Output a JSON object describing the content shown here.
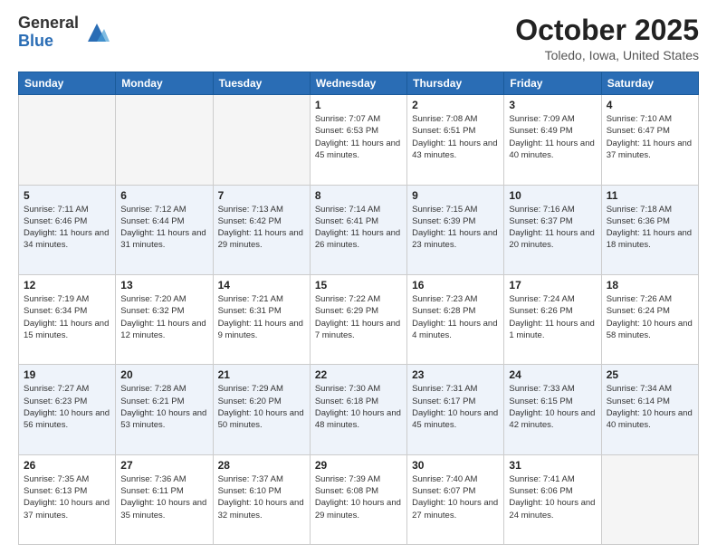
{
  "logo": {
    "general": "General",
    "blue": "Blue"
  },
  "header": {
    "month": "October 2025",
    "location": "Toledo, Iowa, United States"
  },
  "days_of_week": [
    "Sunday",
    "Monday",
    "Tuesday",
    "Wednesday",
    "Thursday",
    "Friday",
    "Saturday"
  ],
  "weeks": [
    [
      {
        "day": "",
        "info": ""
      },
      {
        "day": "",
        "info": ""
      },
      {
        "day": "",
        "info": ""
      },
      {
        "day": "1",
        "info": "Sunrise: 7:07 AM\nSunset: 6:53 PM\nDaylight: 11 hours\nand 45 minutes."
      },
      {
        "day": "2",
        "info": "Sunrise: 7:08 AM\nSunset: 6:51 PM\nDaylight: 11 hours\nand 43 minutes."
      },
      {
        "day": "3",
        "info": "Sunrise: 7:09 AM\nSunset: 6:49 PM\nDaylight: 11 hours\nand 40 minutes."
      },
      {
        "day": "4",
        "info": "Sunrise: 7:10 AM\nSunset: 6:47 PM\nDaylight: 11 hours\nand 37 minutes."
      }
    ],
    [
      {
        "day": "5",
        "info": "Sunrise: 7:11 AM\nSunset: 6:46 PM\nDaylight: 11 hours\nand 34 minutes."
      },
      {
        "day": "6",
        "info": "Sunrise: 7:12 AM\nSunset: 6:44 PM\nDaylight: 11 hours\nand 31 minutes."
      },
      {
        "day": "7",
        "info": "Sunrise: 7:13 AM\nSunset: 6:42 PM\nDaylight: 11 hours\nand 29 minutes."
      },
      {
        "day": "8",
        "info": "Sunrise: 7:14 AM\nSunset: 6:41 PM\nDaylight: 11 hours\nand 26 minutes."
      },
      {
        "day": "9",
        "info": "Sunrise: 7:15 AM\nSunset: 6:39 PM\nDaylight: 11 hours\nand 23 minutes."
      },
      {
        "day": "10",
        "info": "Sunrise: 7:16 AM\nSunset: 6:37 PM\nDaylight: 11 hours\nand 20 minutes."
      },
      {
        "day": "11",
        "info": "Sunrise: 7:18 AM\nSunset: 6:36 PM\nDaylight: 11 hours\nand 18 minutes."
      }
    ],
    [
      {
        "day": "12",
        "info": "Sunrise: 7:19 AM\nSunset: 6:34 PM\nDaylight: 11 hours\nand 15 minutes."
      },
      {
        "day": "13",
        "info": "Sunrise: 7:20 AM\nSunset: 6:32 PM\nDaylight: 11 hours\nand 12 minutes."
      },
      {
        "day": "14",
        "info": "Sunrise: 7:21 AM\nSunset: 6:31 PM\nDaylight: 11 hours\nand 9 minutes."
      },
      {
        "day": "15",
        "info": "Sunrise: 7:22 AM\nSunset: 6:29 PM\nDaylight: 11 hours\nand 7 minutes."
      },
      {
        "day": "16",
        "info": "Sunrise: 7:23 AM\nSunset: 6:28 PM\nDaylight: 11 hours\nand 4 minutes."
      },
      {
        "day": "17",
        "info": "Sunrise: 7:24 AM\nSunset: 6:26 PM\nDaylight: 11 hours\nand 1 minute."
      },
      {
        "day": "18",
        "info": "Sunrise: 7:26 AM\nSunset: 6:24 PM\nDaylight: 10 hours\nand 58 minutes."
      }
    ],
    [
      {
        "day": "19",
        "info": "Sunrise: 7:27 AM\nSunset: 6:23 PM\nDaylight: 10 hours\nand 56 minutes."
      },
      {
        "day": "20",
        "info": "Sunrise: 7:28 AM\nSunset: 6:21 PM\nDaylight: 10 hours\nand 53 minutes."
      },
      {
        "day": "21",
        "info": "Sunrise: 7:29 AM\nSunset: 6:20 PM\nDaylight: 10 hours\nand 50 minutes."
      },
      {
        "day": "22",
        "info": "Sunrise: 7:30 AM\nSunset: 6:18 PM\nDaylight: 10 hours\nand 48 minutes."
      },
      {
        "day": "23",
        "info": "Sunrise: 7:31 AM\nSunset: 6:17 PM\nDaylight: 10 hours\nand 45 minutes."
      },
      {
        "day": "24",
        "info": "Sunrise: 7:33 AM\nSunset: 6:15 PM\nDaylight: 10 hours\nand 42 minutes."
      },
      {
        "day": "25",
        "info": "Sunrise: 7:34 AM\nSunset: 6:14 PM\nDaylight: 10 hours\nand 40 minutes."
      }
    ],
    [
      {
        "day": "26",
        "info": "Sunrise: 7:35 AM\nSunset: 6:13 PM\nDaylight: 10 hours\nand 37 minutes."
      },
      {
        "day": "27",
        "info": "Sunrise: 7:36 AM\nSunset: 6:11 PM\nDaylight: 10 hours\nand 35 minutes."
      },
      {
        "day": "28",
        "info": "Sunrise: 7:37 AM\nSunset: 6:10 PM\nDaylight: 10 hours\nand 32 minutes."
      },
      {
        "day": "29",
        "info": "Sunrise: 7:39 AM\nSunset: 6:08 PM\nDaylight: 10 hours\nand 29 minutes."
      },
      {
        "day": "30",
        "info": "Sunrise: 7:40 AM\nSunset: 6:07 PM\nDaylight: 10 hours\nand 27 minutes."
      },
      {
        "day": "31",
        "info": "Sunrise: 7:41 AM\nSunset: 6:06 PM\nDaylight: 10 hours\nand 24 minutes."
      },
      {
        "day": "",
        "info": ""
      }
    ]
  ]
}
